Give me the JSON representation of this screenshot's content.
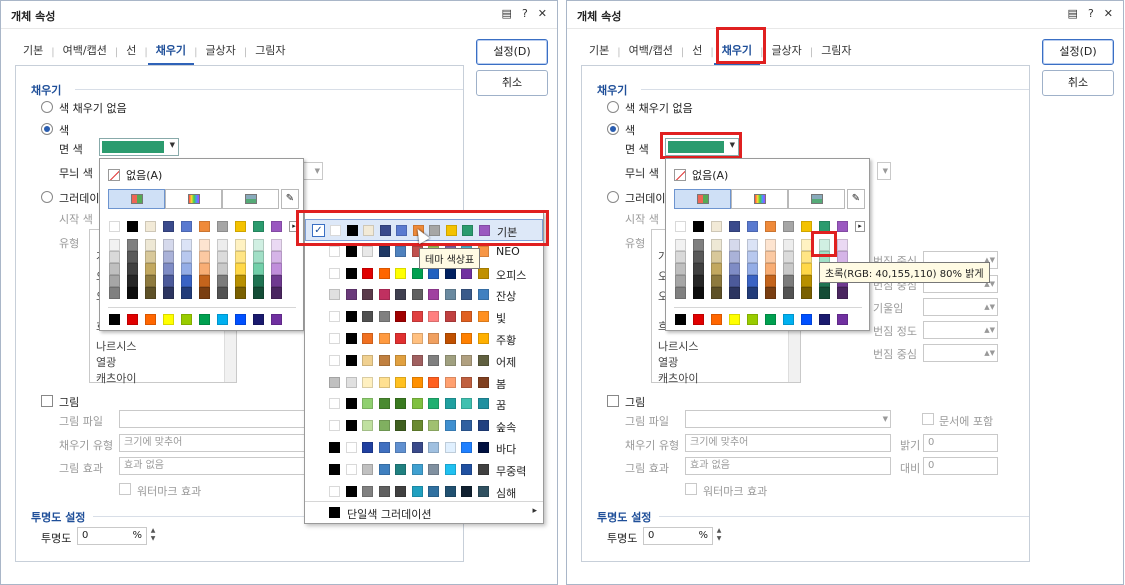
{
  "dialog": {
    "title": "개체 속성",
    "title_icons": [
      "▤",
      "?",
      "✕"
    ]
  },
  "tabs": [
    "기본",
    "여백/캡션",
    "선",
    "채우기",
    "글상자",
    "그림자"
  ],
  "buttons": {
    "ok": "설정(D)",
    "cancel": "취소"
  },
  "fill": {
    "header": "채우기",
    "no_fill": "색 채우기 없음",
    "color": "색",
    "face_color_label": "면 색",
    "pattern_color_label": "무늬 색",
    "gradient": "그러데이션",
    "start_color": "시작 색",
    "type_label": "유형",
    "gradient_list_items": [
      "나르시스",
      "열광",
      "캐츠아이"
    ],
    "gradient_list_partial": [
      "가",
      "오",
      "오",
      "흐"
    ],
    "gradient_right_labels": [
      "번짐 중심",
      "번짐 중심",
      "기울임",
      "번짐 정도",
      "번짐 중심"
    ],
    "picture": "그림",
    "picture_file": "그림 파일",
    "fill_type": "채우기 유형",
    "fill_type_value": "크기에 맞추어",
    "picture_effect": "그림 효과",
    "picture_effect_value": "효과 없음",
    "watermark": "워터마크 효과",
    "include_in_doc": "문서에 포함",
    "brightness": "밝기",
    "contrast": "대비",
    "zero": "0"
  },
  "transparency": {
    "header": "투명도 설정",
    "label": "투명도",
    "value": "0",
    "unit": "%"
  },
  "popup": {
    "none_label": "없음(A)"
  },
  "theme_menu": {
    "items": [
      "기본",
      "NEO",
      "오피스",
      "잔상",
      "빛",
      "주황",
      "어제",
      "봄",
      "꿈",
      "숲속",
      "바다",
      "무중력",
      "심해"
    ],
    "footer": "단일색 그러데이션",
    "footer_arrow": "▸"
  },
  "tooltips": {
    "theme": "테마 색상표",
    "cell": "초록(RGB: 40,155,110) 80% 밝게"
  },
  "colors": {
    "accent": "#2f62b8",
    "selected_fill": "#2b9b6e",
    "highlight": "#e02020"
  }
}
